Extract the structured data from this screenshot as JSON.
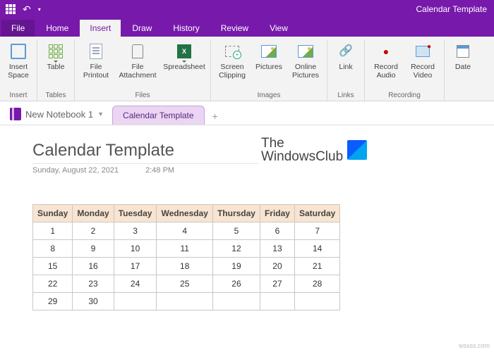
{
  "window": {
    "title": "Calendar Template"
  },
  "tabs": {
    "file": "File",
    "home": "Home",
    "insert": "Insert",
    "draw": "Draw",
    "history": "History",
    "review": "Review",
    "view": "View"
  },
  "ribbon": {
    "insert_space": "Insert\nSpace",
    "table": "Table",
    "file_printout": "File\nPrintout",
    "file_attachment": "File\nAttachment",
    "spreadsheet": "Spreadsheet",
    "screen_clipping": "Screen\nClipping",
    "pictures": "Pictures",
    "online_pictures": "Online\nPictures",
    "link": "Link",
    "record_audio": "Record\nAudio",
    "record_video": "Record\nVideo",
    "date": "Date",
    "g_insert": "Insert",
    "g_tables": "Tables",
    "g_files": "Files",
    "g_images": "Images",
    "g_links": "Links",
    "g_recording": "Recording"
  },
  "notebook": {
    "name": "New Notebook 1",
    "page_tab": "Calendar Template"
  },
  "page": {
    "title": "Calendar Template",
    "date": "Sunday, August 22, 2021",
    "time": "2:48 PM"
  },
  "brand": {
    "line1": "The",
    "line2": "WindowsClub"
  },
  "calendar": {
    "headers": [
      "Sunday",
      "Monday",
      "Tuesday",
      "Wednesday",
      "Thursday",
      "Friday",
      "Saturday"
    ],
    "rows": [
      [
        "1",
        "2",
        "3",
        "4",
        "5",
        "6",
        "7"
      ],
      [
        "8",
        "9",
        "10",
        "11",
        "12",
        "13",
        "14"
      ],
      [
        "15",
        "16",
        "17",
        "18",
        "19",
        "20",
        "21"
      ],
      [
        "22",
        "23",
        "24",
        "25",
        "26",
        "27",
        "28"
      ],
      [
        "29",
        "30",
        "",
        "",
        "",
        "",
        ""
      ]
    ]
  },
  "watermark": "wsxss.com"
}
